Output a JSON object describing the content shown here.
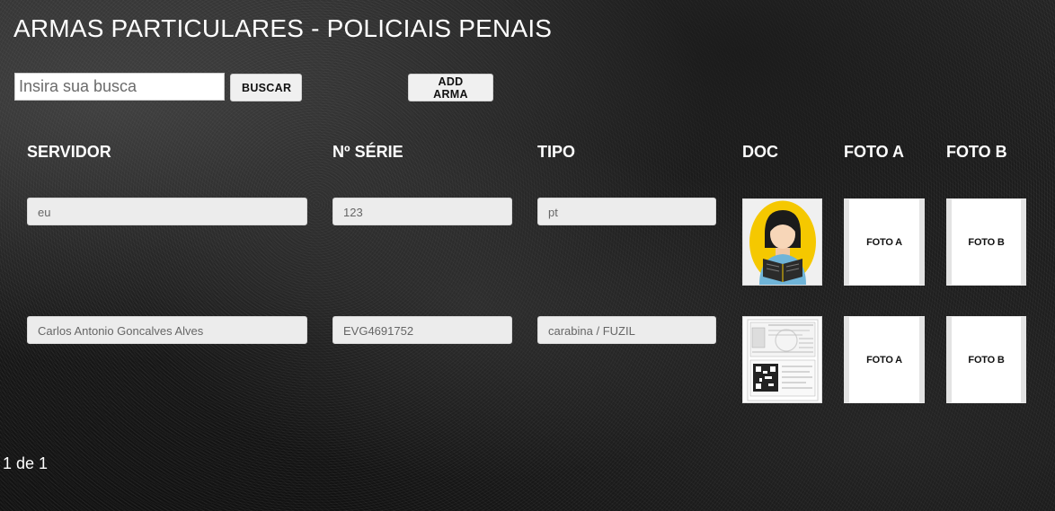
{
  "page": {
    "title": "ARMAS PARTICULARES - POLICIAIS PENAIS"
  },
  "search": {
    "placeholder": "Insira sua busca",
    "value": "",
    "button_label": "BUSCAR"
  },
  "actions": {
    "add_label": "ADD ARMA"
  },
  "table": {
    "headers": {
      "servidor": "SERVIDOR",
      "serie": "Nº SÉRIE",
      "tipo": "TIPO",
      "doc": "DOC",
      "foto_a": "FOTO A",
      "foto_b": "FOTO B"
    },
    "rows": [
      {
        "servidor": "eu",
        "serie": "123",
        "tipo": "pt",
        "doc_icon": "person-reading-avatar",
        "foto_a": "FOTO A",
        "foto_b": "FOTO B"
      },
      {
        "servidor": "Carlos Antonio Goncalves Alves",
        "serie": "EVG4691752",
        "tipo": "carabina / FUZIL",
        "doc_icon": "document-scan-thumbnail",
        "foto_a": "FOTO A",
        "foto_b": "FOTO B"
      }
    ]
  },
  "pagination": {
    "text": "1 de 1"
  },
  "colors": {
    "field_bg": "#ececec",
    "button_bg": "#f0f0f0",
    "avatar_bg": "#f5c800"
  }
}
